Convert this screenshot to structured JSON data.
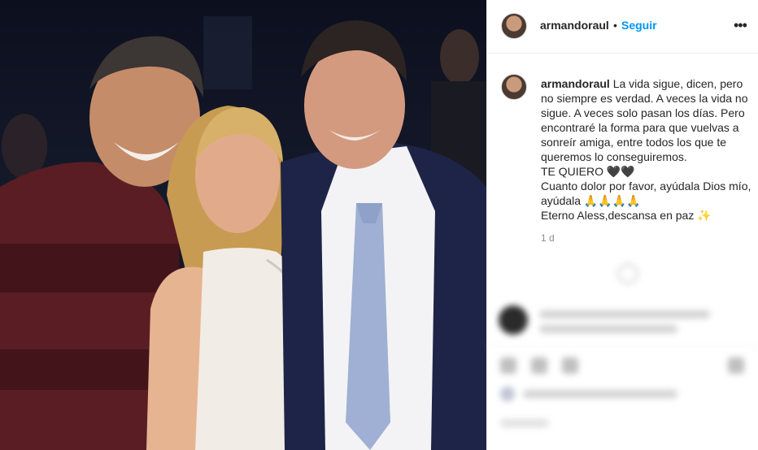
{
  "post": {
    "username": "armandoraul",
    "separator": "•",
    "follow_label": "Seguir",
    "more_icon": "more-options-icon"
  },
  "caption": {
    "username": "armandoraul",
    "line1": "La vida sigue, dicen, pero no siempre es verdad. A veces la vida no sigue. A veces solo pasan los días. Pero encontraré la forma para que vuelvas a sonreír amiga, entre todos los que te queremos lo conseguiremos.",
    "line2": "TE QUIERO 🖤🖤",
    "line3": "Cuanto dolor por favor, ayúdala Dios mío, ayúdala 🙏🙏🙏🙏",
    "line4": "Eterno Aless,descansa en paz ✨"
  },
  "timestamp": "1 d",
  "colors": {
    "link_blue": "#0095f6",
    "text": "#262626",
    "muted": "#8e8e8e"
  }
}
